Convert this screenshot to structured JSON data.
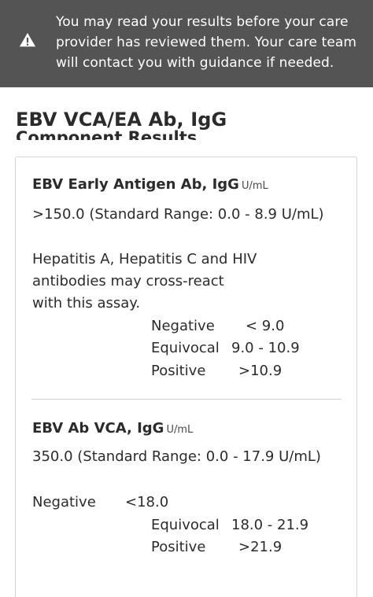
{
  "banner": {
    "icon": "warning-icon",
    "message": "You may read your results before your care provider has reviewed them. Your care team will contact you with guidance if needed."
  },
  "page": {
    "title": "EBV VCA/EA Ab, IgG",
    "section_heading": "Component Results"
  },
  "components": [
    {
      "name": "EBV Early Antigen Ab, IgG",
      "unit": "U/mL",
      "value_line": ">150.0 (Standard Range: 0.0 - 8.9 U/mL)",
      "comment": [
        "Hepatitis A, Hepatitis C and HIV",
        "antibodies may cross-react",
        "with this assay."
      ],
      "interpretation": [
        {
          "label": "Negative",
          "range": "< 9.0"
        },
        {
          "label": "Equivocal",
          "range": "9.0 - 10.9"
        },
        {
          "label": "Positive",
          "range": ">10.9"
        }
      ]
    },
    {
      "name": "EBV Ab VCA, IgG",
      "unit": "U/mL",
      "value_line": "350.0 (Standard Range: 0.0 - 17.9 U/mL)",
      "interpretation": [
        {
          "label": "Negative",
          "range": "<18.0"
        },
        {
          "label": "Equivocal",
          "range": "18.0 - 21.9"
        },
        {
          "label": "Positive",
          "range": ">21.9"
        }
      ]
    }
  ],
  "colors": {
    "banner_bg": "#545454",
    "text": "#2b2b2b",
    "border": "#d4d4d4"
  }
}
